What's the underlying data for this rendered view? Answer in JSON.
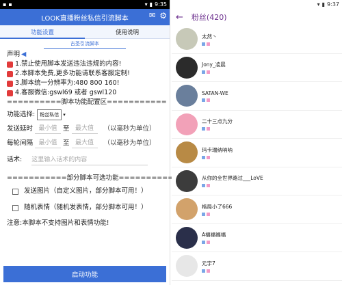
{
  "left": {
    "status_time": "9:35",
    "title": "LOOK直播粉丝私信引流脚本",
    "tabs": [
      "功能设置",
      "使用说明"
    ],
    "subtitle": "古圣引流脚本",
    "lines": [
      "声明",
      "1.禁止使用脚本发送违法违规的内容!",
      "2.本脚本免费,更多功能请联系客服定制!",
      "3.脚本统一分辨率为:480  800  160!",
      "4.客服微信:gswl69 或者 gswl120",
      "==========脚本功能配置区==========="
    ],
    "function_label": "功能选择:",
    "function_value": "粉丝私信",
    "send_delay": "发送延时",
    "interval": "每轮间隔",
    "min_placeholder": "最小值",
    "to": "至",
    "max_placeholder": "最大值",
    "unit": "（以毫秒为单位）",
    "words_label": "话术:",
    "words_placeholder": "这里输入话术的内容",
    "optional_header": "===========部分脚本可选功能===========",
    "opt1": "发送图片（自定义图片，部分脚本可用！）",
    "opt2": "随机表情（随机发表情，部分脚本可用！）",
    "warning": "注意:本脚本不支持图片和表情功能!",
    "start": "启动功能"
  },
  "right": {
    "status_time": "9:37",
    "title": "粉丝(420)",
    "fans": [
      {
        "name": "太然丶",
        "color": "#c7c9b8"
      },
      {
        "name": "Jony_凌晨",
        "color": "#2b2b2b"
      },
      {
        "name": "SATAN-WE",
        "color": "#6a7f9c"
      },
      {
        "name": "二十三点九分",
        "color": "#f2a1b8"
      },
      {
        "name": "玛卡瑞纳呐呐",
        "color": "#b88a45"
      },
      {
        "name": "从你的全世界路过___LoVE",
        "color": "#3c3c3c"
      },
      {
        "name": "格局小了666",
        "color": "#d2a26b"
      },
      {
        "name": "A福福福福",
        "color": "#2a2f4a"
      },
      {
        "name": "元宇7",
        "color": "#e7e7e7"
      }
    ]
  }
}
